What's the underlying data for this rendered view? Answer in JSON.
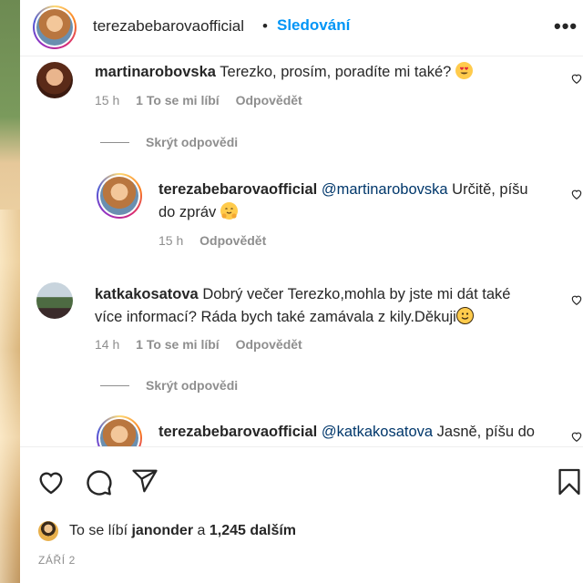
{
  "header": {
    "username": "terezabebarovaofficial",
    "separator": "•",
    "follow_label": "Sledování",
    "more_label": "•••"
  },
  "comments": [
    {
      "user": "martinarobovska",
      "text": "Terezko, prosím, poradíte mi také?",
      "emoji": "heart-eyes-emoji",
      "time": "15 h",
      "likes": "1 To se mi líbí",
      "reply": "Odpovědět",
      "hide_replies": "Skrýt odpovědi"
    },
    {
      "user": "terezabebarovaofficial",
      "mention": "@martinarobovska",
      "text_line1": "Určitě, píšu",
      "text_line2": "do zpráv",
      "emoji": "hugging-emoji",
      "time": "15 h",
      "reply": "Odpovědět"
    },
    {
      "user": "katkakosatova",
      "text_line1": "Dobrý večer Terezko,mohla by jste mi dát také",
      "text_line2": "více informací? Ráda bych také zamávala z kily.Děkuji",
      "emoji": "smiling-emoji",
      "time": "14 h",
      "likes": "1 To se mi líbí",
      "reply": "Odpovědět",
      "hide_replies": "Skrýt odpovědi"
    },
    {
      "user": "terezabebarovaofficial",
      "mention": "@katkakosatova",
      "text": "Jasně, píšu do"
    }
  ],
  "actions": {
    "liked_by_prefix": "To se líbí",
    "liked_by_user": "janonder",
    "liked_by_and": "a",
    "liked_by_others": "1,245 dalším",
    "date": "ZÁŘÍ 2"
  },
  "colors": {
    "follow_blue": "#0095f6",
    "mention": "#00376b",
    "meta_gray": "#8e8e8e",
    "text": "#262626"
  }
}
